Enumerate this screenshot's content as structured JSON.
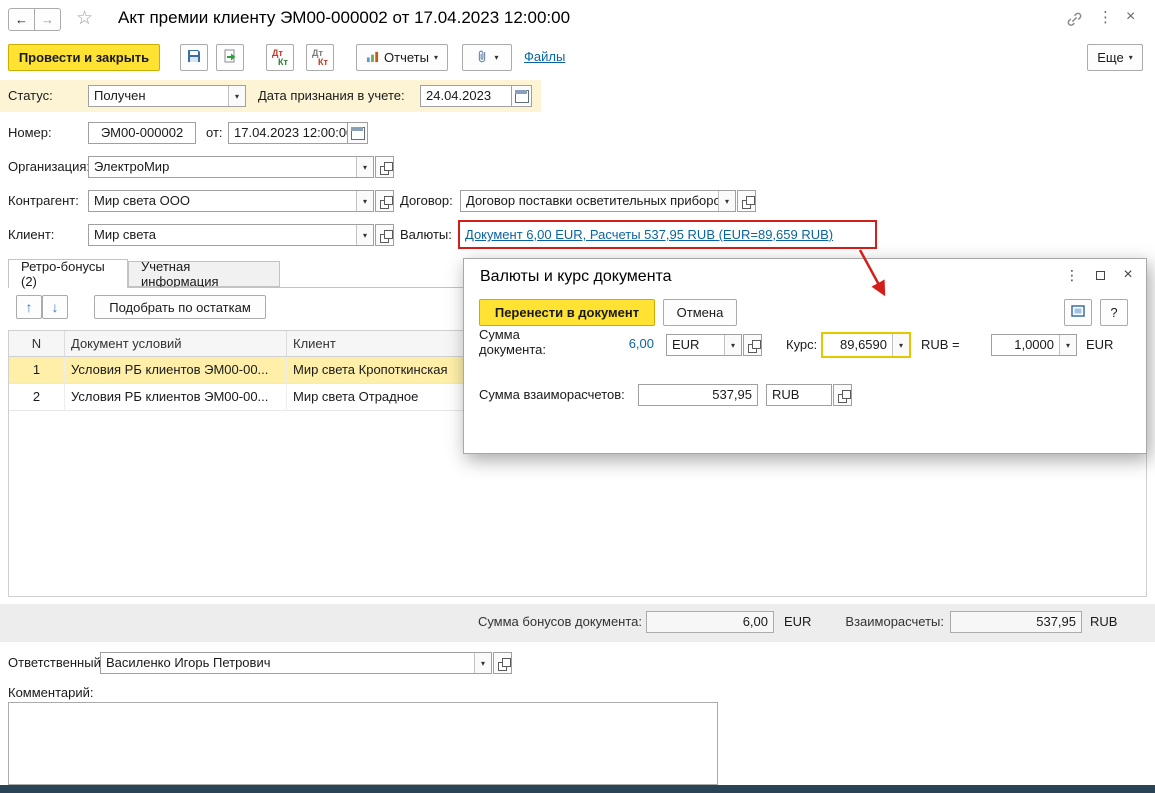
{
  "colors": {
    "accent_yellow": "#ffe232",
    "highlight_red": "#d21f1a",
    "link_blue": "#0a64a4",
    "row_selection": "#ffefa9",
    "status_strip": "#fcf4d4"
  },
  "icons": {
    "back": "←",
    "forward": "→",
    "star": "☆",
    "menu": "⋮",
    "close": "×",
    "dropdown": "▾",
    "up": "↑",
    "down": "↓",
    "help": "?"
  },
  "titlebar": {
    "title": "Акт премии клиенту ЭМ00-000002 от 17.04.2023 12:00:00"
  },
  "toolbar": {
    "post_close": "Провести и закрыть",
    "dt": "Дт",
    "kt": "Кт",
    "reports": "Отчеты",
    "files": "Файлы",
    "more": "Еще"
  },
  "status_row": {
    "status_label": "Статус:",
    "status_value": "Получен",
    "date_label": "Дата признания в учете:",
    "date_value": "24.04.2023"
  },
  "doc_fields": {
    "number_label": "Номер:",
    "number_value": "ЭМ00-000002",
    "from_label": "от:",
    "from_value": "17.04.2023 12:00:00",
    "org_label": "Организация:",
    "org_value": "ЭлектроМир",
    "counterparty_label": "Контрагент:",
    "counterparty_value": "Мир света ООО",
    "contract_label": "Договор:",
    "contract_value": "Договор поставки осветительных приборс",
    "client_label": "Клиент:",
    "client_value": "Мир света",
    "currencies_label": "Валюты:",
    "currencies_link": "Документ 6,00 EUR, Расчеты 537,95 RUB (EUR=89,659 RUB)"
  },
  "tabs": [
    {
      "label": "Ретро-бонусы (2)"
    },
    {
      "label": "Учетная информация"
    }
  ],
  "grid": {
    "pick_button": "Подобрать по остаткам",
    "headers": [
      "N",
      "Документ условий",
      "Клиент"
    ],
    "rows": [
      {
        "n": "1",
        "doc": "Условия РБ клиентов ЭМ00-00...",
        "client": "Мир света Кропоткинская"
      },
      {
        "n": "2",
        "doc": "Условия РБ клиентов ЭМ00-00...",
        "client": "Мир света Отрадное"
      }
    ]
  },
  "dialog": {
    "title": "Валюты и курс документа",
    "transfer_button": "Перенести в документ",
    "cancel_button": "Отмена",
    "amount_label": "Сумма документа:",
    "amount_value": "6,00",
    "amount_currency": "EUR",
    "rate_label": "Курс:",
    "rate_value": "89,6590",
    "rub_equals": "RUB =",
    "rate2_value": "1,0000",
    "rate2_currency": "EUR",
    "settlement_label": "Сумма взаиморасчетов:",
    "settlement_value": "537,95",
    "settlement_currency": "RUB"
  },
  "totals": {
    "bonus_label": "Сумма бонусов документа:",
    "bonus_value": "6,00",
    "bonus_currency": "EUR",
    "settlement_label": "Взаиморасчеты:",
    "settlement_value": "537,95",
    "settlement_currency": "RUB"
  },
  "footer": {
    "responsible_label": "Ответственный:",
    "responsible_value": "Василенко Игорь Петрович",
    "comment_label": "Комментарий:"
  }
}
